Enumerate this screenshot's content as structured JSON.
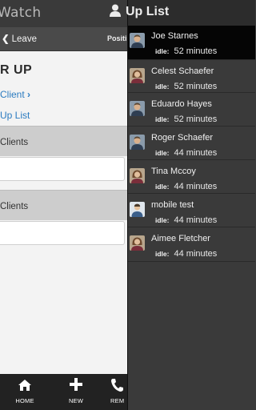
{
  "app": {
    "title": "Watch",
    "leave_label": "Leave",
    "position_label": "Positi",
    "heading": "R UP",
    "link_client": "Client",
    "link_uplist": "Up List",
    "section1_label": "Clients",
    "section2_label": "Clients"
  },
  "tabs": [
    {
      "label": "HOME",
      "icon": "home-icon"
    },
    {
      "label": "NEW",
      "icon": "plus-icon"
    },
    {
      "label": "REM",
      "icon": "phone-icon"
    }
  ],
  "panel": {
    "title": "Up List",
    "icon": "user-icon",
    "idle_key": "idle:",
    "users": [
      {
        "name": "Joe Starnes",
        "idle": "52 minutes",
        "selected": true,
        "avatar": "male-avatar"
      },
      {
        "name": "Celest Schaefer",
        "idle": "52 minutes",
        "selected": false,
        "avatar": "female-avatar"
      },
      {
        "name": "Eduardo Hayes",
        "idle": "52 minutes",
        "selected": false,
        "avatar": "male-avatar"
      },
      {
        "name": "Roger Schaefer",
        "idle": "44 minutes",
        "selected": false,
        "avatar": "male-avatar"
      },
      {
        "name": "Tina Mccoy",
        "idle": "44 minutes",
        "selected": false,
        "avatar": "female-avatar"
      },
      {
        "name": "mobile test",
        "idle": "44 minutes",
        "selected": false,
        "avatar": "placeholder-avatar"
      },
      {
        "name": "Aimee Fletcher",
        "idle": "44 minutes",
        "selected": false,
        "avatar": "female-avatar"
      }
    ]
  },
  "colors": {
    "panel_bg": "#3a3a3a",
    "selected_row": "#050505",
    "link_blue": "#2b7bc0",
    "section_gray": "#cdcdcd",
    "tabbar": "#222222"
  }
}
